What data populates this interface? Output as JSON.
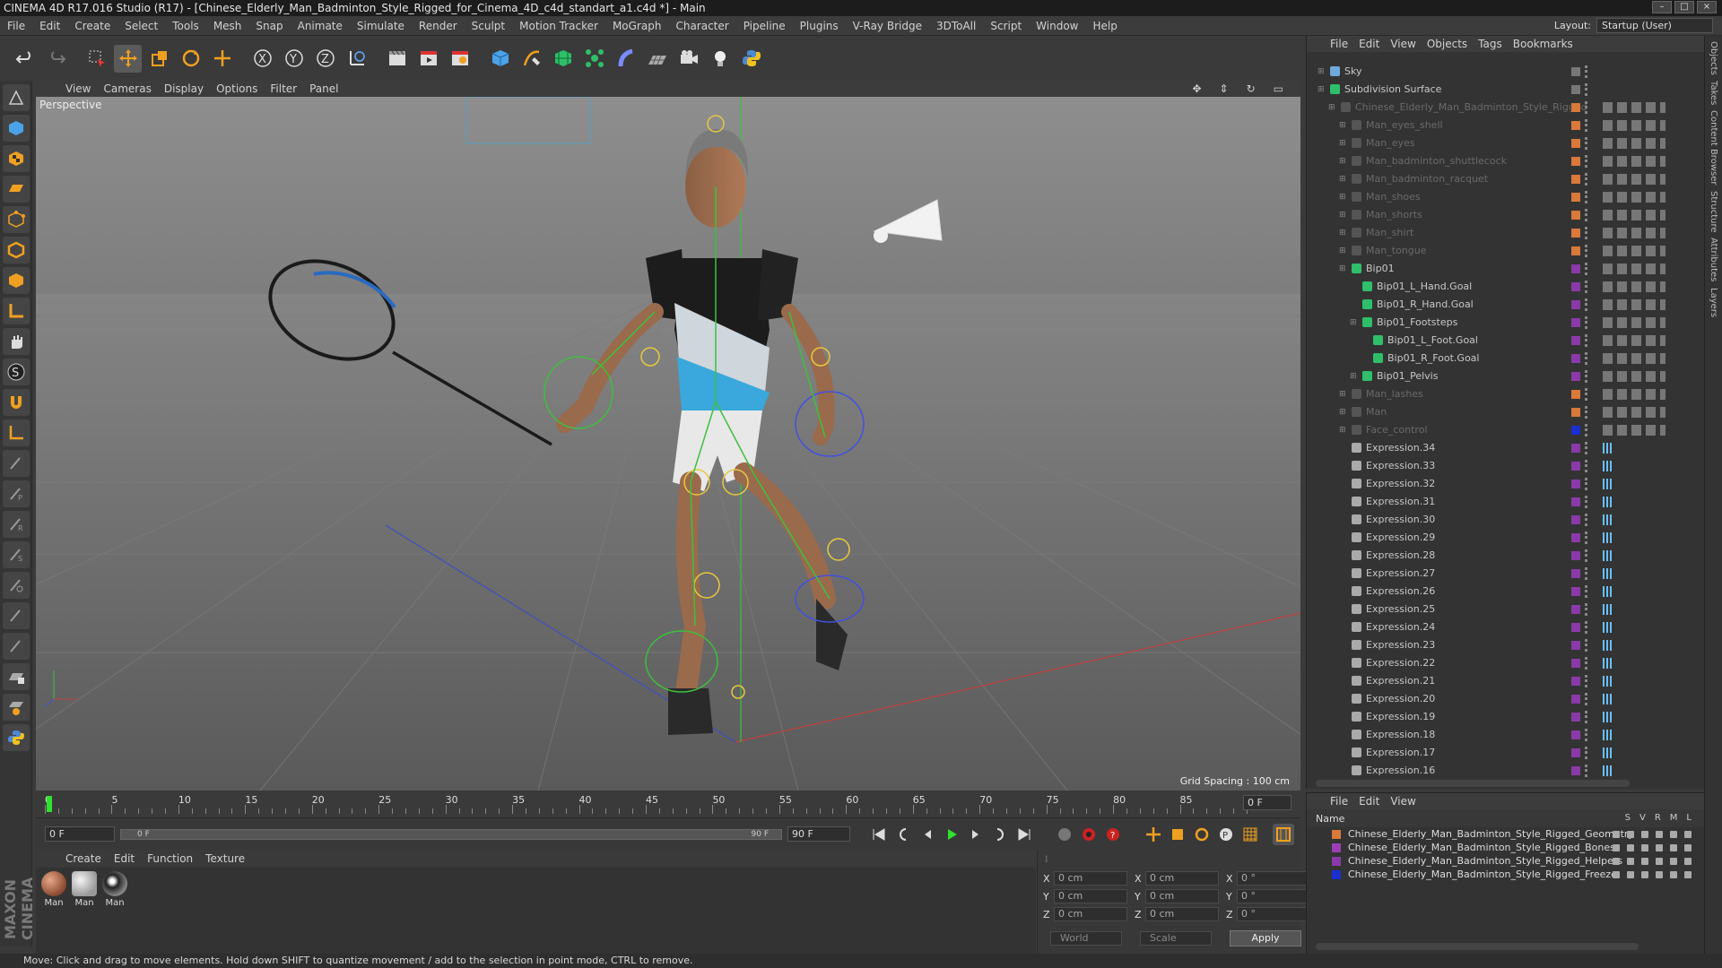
{
  "window": {
    "title": "CINEMA 4D R17.016 Studio (R17) - [Chinese_Elderly_Man_Badminton_Style_Rigged_for_Cinema_4D_c4d_standart_a1.c4d *] - Main"
  },
  "menu": [
    "File",
    "Edit",
    "Create",
    "Select",
    "Tools",
    "Mesh",
    "Snap",
    "Animate",
    "Simulate",
    "Render",
    "Sculpt",
    "Motion Tracker",
    "MoGraph",
    "Character",
    "Pipeline",
    "Plugins",
    "V-Ray Bridge",
    "3DToAll",
    "Script",
    "Window",
    "Help"
  ],
  "layout": {
    "label": "Layout:",
    "value": "Startup (User)"
  },
  "viewport": {
    "menu": [
      "View",
      "Cameras",
      "Display",
      "Options",
      "Filter",
      "Panel"
    ],
    "label": "Perspective",
    "grid_spacing": "Grid Spacing : 100 cm"
  },
  "timeline": {
    "ticks": [
      "0",
      "5",
      "10",
      "15",
      "20",
      "25",
      "30",
      "35",
      "40",
      "45",
      "50",
      "55",
      "60",
      "65",
      "70",
      "75",
      "80",
      "85",
      "90"
    ],
    "current_frame": "0 F"
  },
  "transport": {
    "start": "0 F",
    "range_start": "0 F",
    "range_end": "90 F",
    "end": "90 F"
  },
  "materials": {
    "menu": [
      "Create",
      "Edit",
      "Function",
      "Texture"
    ],
    "items": [
      {
        "label": "Man"
      },
      {
        "label": "Man"
      },
      {
        "label": "Man"
      }
    ]
  },
  "coords": {
    "rows": [
      {
        "a": "X",
        "av": "0 cm",
        "b": "X",
        "bv": "0 cm",
        "c": "X",
        "cv": "0 °"
      },
      {
        "a": "Y",
        "av": "0 cm",
        "b": "Y",
        "bv": "0 cm",
        "c": "Y",
        "cv": "0 °"
      },
      {
        "a": "Z",
        "av": "0 cm",
        "b": "Z",
        "bv": "0 cm",
        "c": "Z",
        "cv": "0 °"
      }
    ],
    "space": "World",
    "mode": "Scale",
    "apply": "Apply"
  },
  "objects": {
    "menu": [
      "File",
      "Edit",
      "View",
      "Objects",
      "Tags",
      "Bookmarks"
    ],
    "items": [
      {
        "name": "Sky",
        "indent": 0,
        "dim": false
      },
      {
        "name": "Subdivision Surface",
        "indent": 0,
        "dim": false
      },
      {
        "name": "Chinese_Elderly_Man_Badminton_Style_Rigged",
        "indent": 1,
        "dim": true
      },
      {
        "name": "Man_eyes_shell",
        "indent": 2,
        "dim": true
      },
      {
        "name": "Man_eyes",
        "indent": 2,
        "dim": true
      },
      {
        "name": "Man_badminton_shuttlecock",
        "indent": 2,
        "dim": true
      },
      {
        "name": "Man_badminton_racquet",
        "indent": 2,
        "dim": true
      },
      {
        "name": "Man_shoes",
        "indent": 2,
        "dim": true
      },
      {
        "name": "Man_shorts",
        "indent": 2,
        "dim": true
      },
      {
        "name": "Man_shirt",
        "indent": 2,
        "dim": true
      },
      {
        "name": "Man_tongue",
        "indent": 2,
        "dim": true
      },
      {
        "name": "Bip01",
        "indent": 2,
        "dim": false
      },
      {
        "name": "Bip01_L_Hand.Goal",
        "indent": 3,
        "dim": false
      },
      {
        "name": "Bip01_R_Hand.Goal",
        "indent": 3,
        "dim": false
      },
      {
        "name": "Bip01_Footsteps",
        "indent": 3,
        "dim": false
      },
      {
        "name": "Bip01_L_Foot.Goal",
        "indent": 4,
        "dim": false
      },
      {
        "name": "Bip01_R_Foot.Goal",
        "indent": 4,
        "dim": false
      },
      {
        "name": "Bip01_Pelvis",
        "indent": 3,
        "dim": false
      },
      {
        "name": "Man_lashes",
        "indent": 2,
        "dim": true
      },
      {
        "name": "Man",
        "indent": 2,
        "dim": true
      },
      {
        "name": "Face_control",
        "indent": 2,
        "dim": true
      },
      {
        "name": "Expression.34",
        "indent": 2,
        "dim": false
      },
      {
        "name": "Expression.33",
        "indent": 2,
        "dim": false
      },
      {
        "name": "Expression.32",
        "indent": 2,
        "dim": false
      },
      {
        "name": "Expression.31",
        "indent": 2,
        "dim": false
      },
      {
        "name": "Expression.30",
        "indent": 2,
        "dim": false
      },
      {
        "name": "Expression.29",
        "indent": 2,
        "dim": false
      },
      {
        "name": "Expression.28",
        "indent": 2,
        "dim": false
      },
      {
        "name": "Expression.27",
        "indent": 2,
        "dim": false
      },
      {
        "name": "Expression.26",
        "indent": 2,
        "dim": false
      },
      {
        "name": "Expression.25",
        "indent": 2,
        "dim": false
      },
      {
        "name": "Expression.24",
        "indent": 2,
        "dim": false
      },
      {
        "name": "Expression.23",
        "indent": 2,
        "dim": false
      },
      {
        "name": "Expression.22",
        "indent": 2,
        "dim": false
      },
      {
        "name": "Expression.21",
        "indent": 2,
        "dim": false
      },
      {
        "name": "Expression.20",
        "indent": 2,
        "dim": false
      },
      {
        "name": "Expression.19",
        "indent": 2,
        "dim": false
      },
      {
        "name": "Expression.18",
        "indent": 2,
        "dim": false
      },
      {
        "name": "Expression.17",
        "indent": 2,
        "dim": false
      },
      {
        "name": "Expression.16",
        "indent": 2,
        "dim": false
      }
    ]
  },
  "layers": {
    "menu": [
      "File",
      "Edit",
      "View"
    ],
    "columns": [
      "Name",
      "S",
      "V",
      "R",
      "M",
      "L"
    ],
    "items": [
      {
        "name": "Chinese_Elderly_Man_Badminton_Style_Rigged_Geometry",
        "color": "#d9793a"
      },
      {
        "name": "Chinese_Elderly_Man_Badminton_Style_Rigged_Bones",
        "color": "#9b3fb5"
      },
      {
        "name": "Chinese_Elderly_Man_Badminton_Style_Rigged_Helpers",
        "color": "#8a3aa8"
      },
      {
        "name": "Chinese_Elderly_Man_Badminton_Style_Rigged_Freeze",
        "color": "#1a2fd0"
      }
    ]
  },
  "side_tabs": [
    "Objects",
    "Takes",
    "Content Browser",
    "Structure",
    "Attributes",
    "Layers"
  ],
  "status": "Move: Click and drag to move elements. Hold down SHIFT to quantize movement / add to the selection in point mode, CTRL to remove.",
  "brand": "MAXON CINEMA 4D",
  "colors": {
    "accent": "#f0a020",
    "bg": "#3a3a3a",
    "green": "#2ee32e"
  }
}
